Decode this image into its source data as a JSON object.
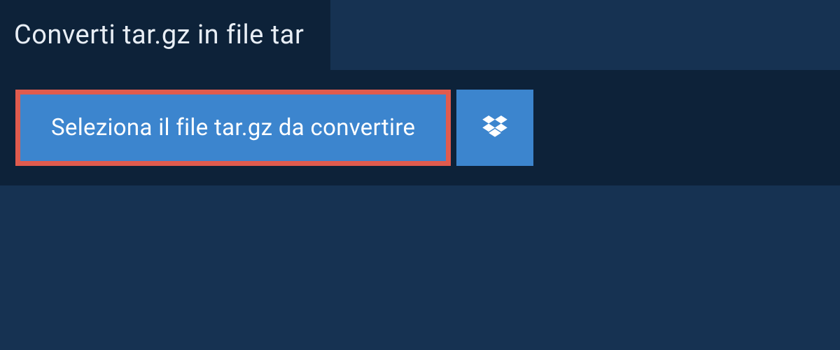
{
  "header": {
    "title": "Converti tar.gz in file tar"
  },
  "actions": {
    "select_file_label": "Seleziona il file tar.gz da convertire"
  },
  "colors": {
    "background_dark": "#0d2239",
    "background_mid": "#163252",
    "button_blue": "#3c85ce",
    "highlight_border": "#e05b4e"
  },
  "icons": {
    "dropbox": "dropbox-icon"
  }
}
